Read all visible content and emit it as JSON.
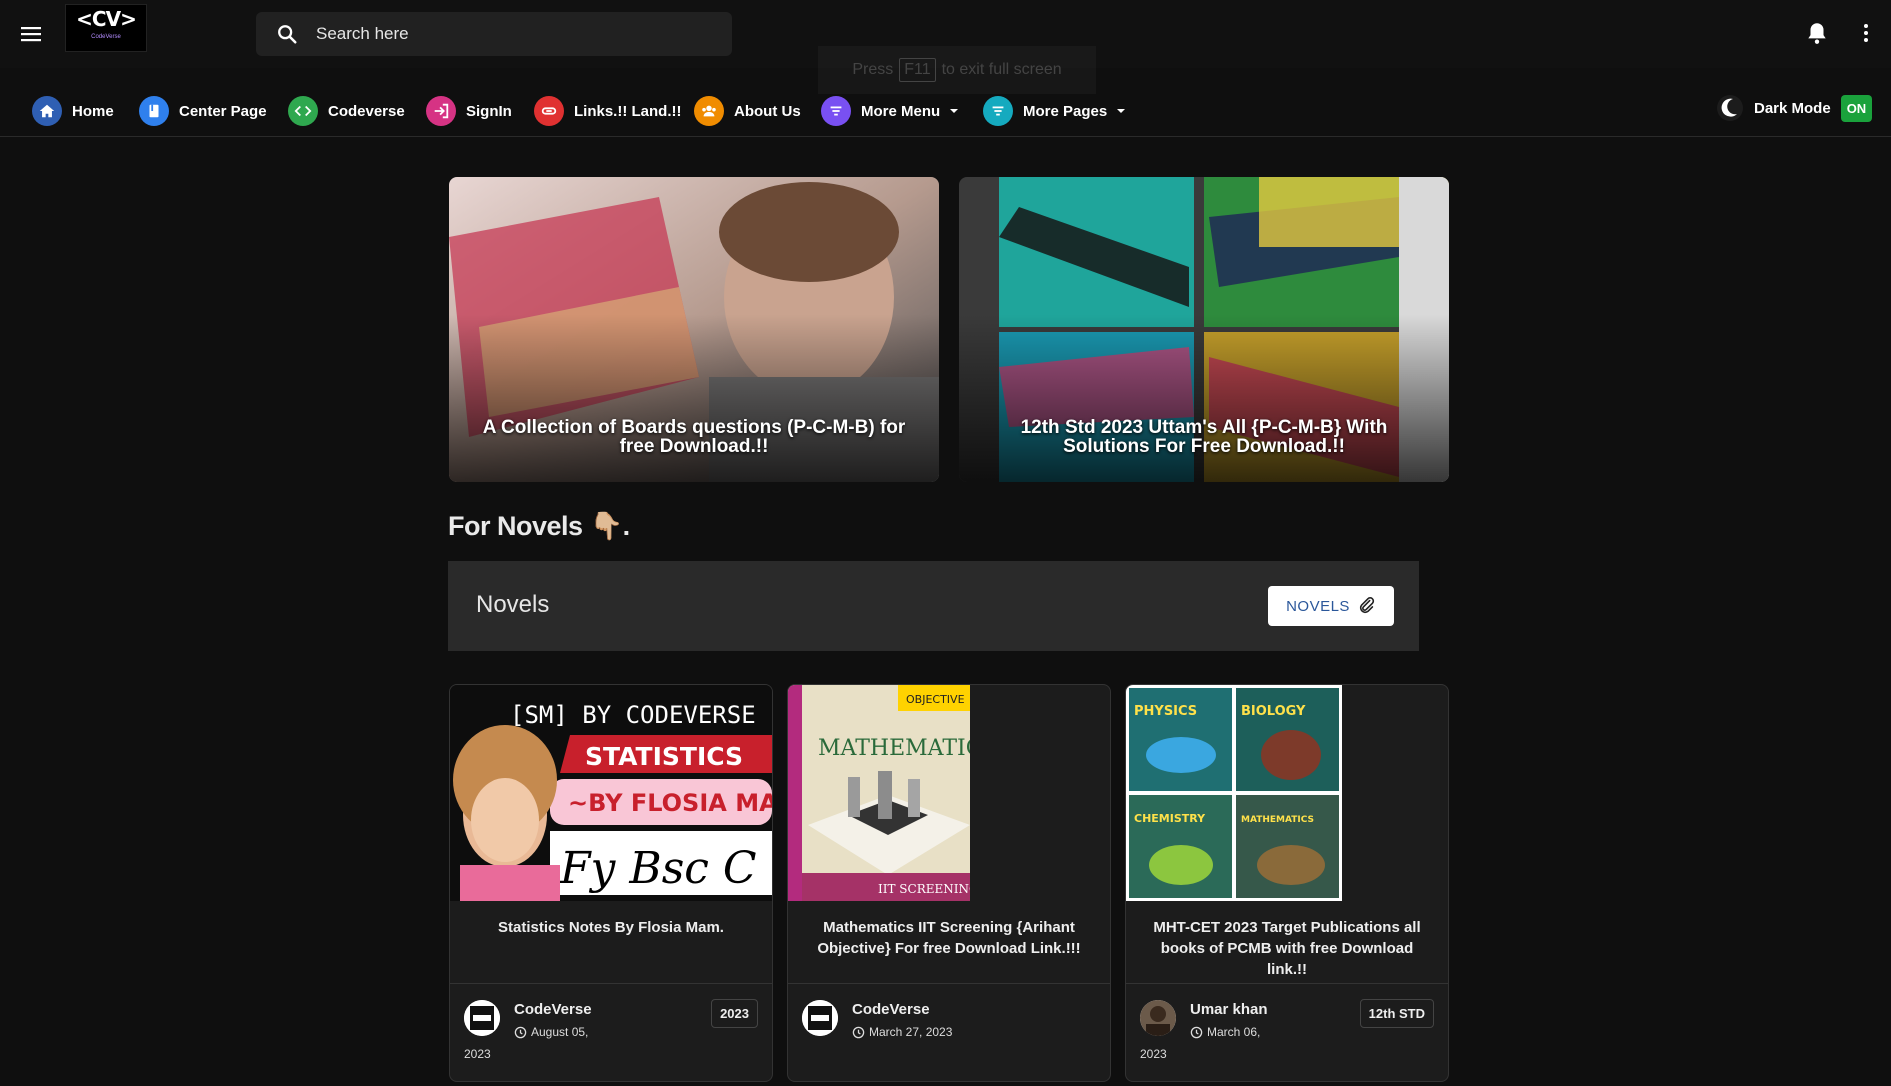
{
  "header": {
    "logo_text": "<CV>",
    "logo_sub": "CodeVerse",
    "search_placeholder": "Search here",
    "fullscreen_hint": {
      "before": "Press",
      "key": "F11",
      "after": "to exit full screen"
    }
  },
  "nav": {
    "items": [
      {
        "label": "Home",
        "icon": "home-icon",
        "color": "#2f5fb3"
      },
      {
        "label": "Center Page",
        "icon": "book-icon",
        "color": "#2f80ed"
      },
      {
        "label": "Codeverse",
        "icon": "code-icon",
        "color": "#2fa84f"
      },
      {
        "label": "SignIn",
        "icon": "signin-icon",
        "color": "#d63384"
      },
      {
        "label": "Links.!! Land.!!",
        "icon": "link-icon",
        "color": "#e03131"
      },
      {
        "label": "About Us",
        "icon": "users-icon",
        "color": "#f08c00"
      },
      {
        "label": "More Menu",
        "icon": "filter-icon",
        "color": "#7950f2"
      },
      {
        "label": "More Pages",
        "icon": "filter-icon",
        "color": "#15aabf"
      }
    ],
    "dark_mode_label": "Dark Mode",
    "dark_mode_state": "ON"
  },
  "featured": [
    {
      "caption": "A Collection of Boards questions (P-C-M-B) for free Download.!!"
    },
    {
      "caption": "12th Std 2023 Uttam's All {P-C-M-B} With Solutions For Free Download.!!"
    }
  ],
  "section": {
    "heading": "For Novels 👇🏼.",
    "box_title": "Novels",
    "button_label": "NOVELS"
  },
  "cards": [
    {
      "title": "Statistics Notes By Flosia Mam.",
      "author": "CodeVerse",
      "date_line1": "August 05,",
      "date_line2": "2023",
      "badge": "2023",
      "thumb": {
        "line1": "[SM] BY CODEVERSE",
        "line2": "STATISTICS",
        "line3": "~BY FLOSIA MAM",
        "line4": "Fy Bsc C"
      }
    },
    {
      "title": "Mathematics IIT Screening {Arihant Objective} For free Download Link.!!!",
      "author": "CodeVerse",
      "date_line1": "March 27, 2023",
      "date_line2": "",
      "badge": "",
      "thumb": {
        "top": "OBJECTIVE",
        "main": "MATHEMATICS",
        "bottom": "IIT SCREENING"
      }
    },
    {
      "title": "MHT-CET 2023 Target Publications all books of PCMB with free Download link.!!",
      "author": "Umar khan",
      "date_line1": "March 06,",
      "date_line2": "2023",
      "badge": "12th STD",
      "thumb": {
        "b1": "PHYSICS",
        "b2": "BIOLOGY",
        "b3": "CHEMISTRY",
        "b4": "MATHEMATICS"
      }
    }
  ]
}
